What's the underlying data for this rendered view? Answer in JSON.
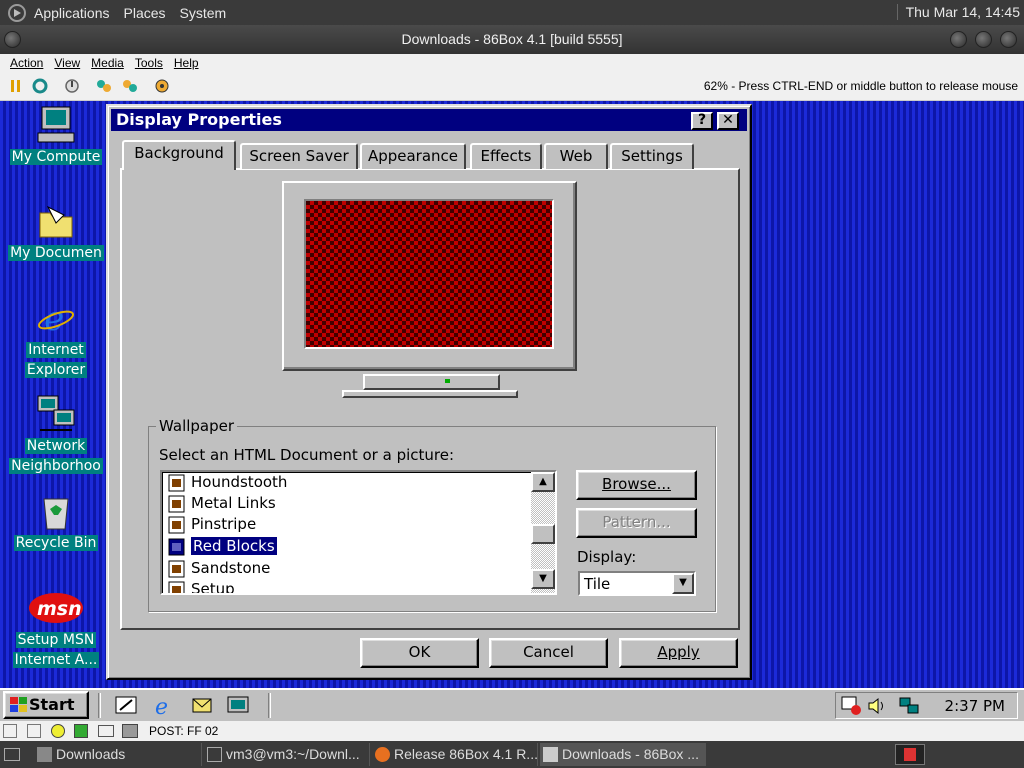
{
  "top_panel": {
    "menus": [
      "Applications",
      "Places",
      "System"
    ],
    "clock": "Thu Mar 14, 14:45"
  },
  "window": {
    "title": "Downloads - 86Box 4.1 [build 5555]"
  },
  "menubar": [
    "Action",
    "View",
    "Media",
    "Tools",
    "Help"
  ],
  "toolbar": {
    "status": "62% - Press CTRL-END or middle button to release mouse"
  },
  "desktop_icons": [
    {
      "label": "My Compute"
    },
    {
      "label": "My Documen"
    },
    {
      "label": "Internet Explorer",
      "line1": "Internet",
      "line2": "Explorer"
    },
    {
      "label": "Network Neighborhoo",
      "line1": "Network",
      "line2": "Neighborhoo"
    },
    {
      "label": "Recycle Bin"
    },
    {
      "label": "Setup MSN Internet A...",
      "line1": "Setup MSN",
      "line2": "Internet A..."
    }
  ],
  "msn_logo": "msn",
  "dialog": {
    "title": "Display Properties",
    "help": "?",
    "close": "✕",
    "tabs": [
      "Background",
      "Screen Saver",
      "Appearance",
      "Effects",
      "Web",
      "Settings"
    ],
    "wallpaper_group": "Wallpaper",
    "select_label": "Select an HTML Document or a picture:",
    "list_items": [
      "Houndstooth",
      "Metal Links",
      "Pinstripe",
      "Red Blocks",
      "Sandstone",
      "Setup"
    ],
    "selected_item": "Red Blocks",
    "browse": "Browse...",
    "pattern": "Pattern...",
    "display_label": "Display:",
    "display_value": "Tile",
    "ok": "OK",
    "cancel": "Cancel",
    "apply": "Apply"
  },
  "taskbar": {
    "start": "Start",
    "clock": "2:37 PM"
  },
  "statusbar": {
    "post": "POST: FF 02"
  },
  "bottom_panel": {
    "tasks": [
      "Downloads",
      "vm3@vm3:~/Downl...",
      "Release 86Box 4.1 R...",
      "Downloads - 86Box ..."
    ]
  }
}
